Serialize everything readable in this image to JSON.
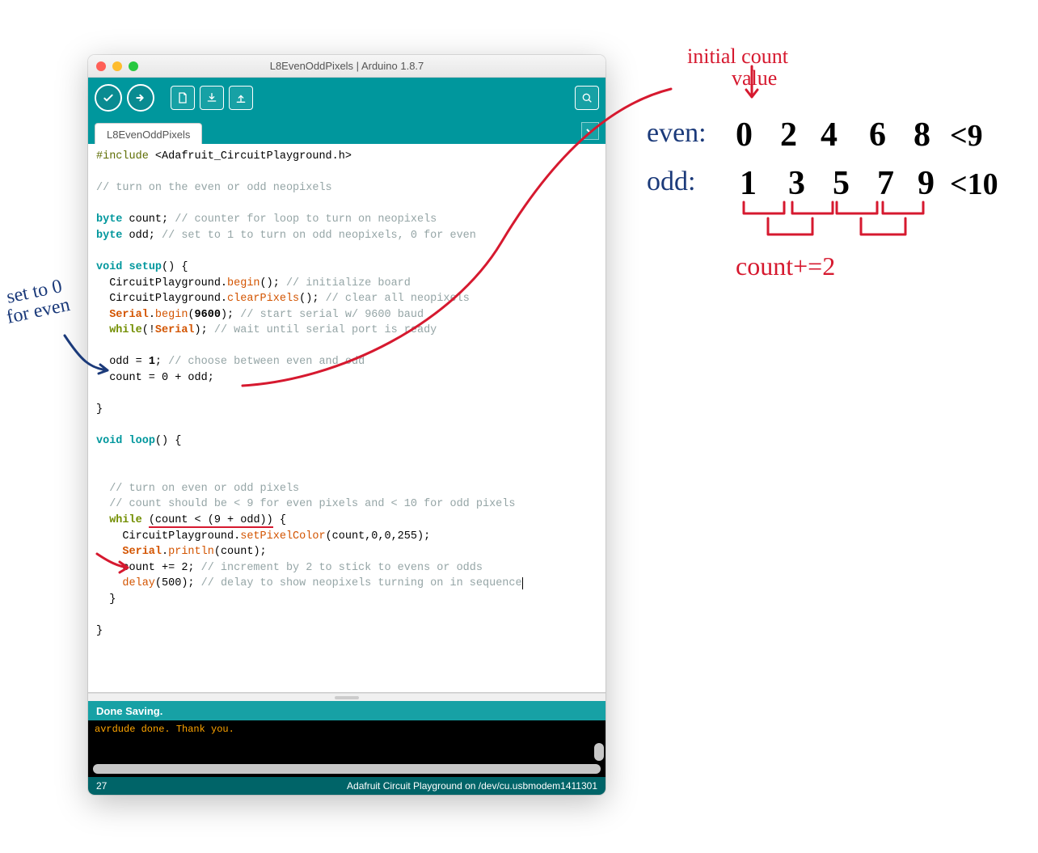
{
  "window": {
    "title": "L8EvenOddPixels | Arduino 1.8.7",
    "tab_label": "L8EvenOddPixels",
    "status_text": "Done Saving.",
    "console_text": "avrdude done.  Thank you.",
    "footer_line": "27",
    "footer_board": "Adafruit Circuit Playground on /dev/cu.usbmodem1411301"
  },
  "toolbar": {
    "buttons": {
      "verify": "verify",
      "upload": "upload",
      "new": "new",
      "open": "open",
      "save": "save",
      "serial": "serial-monitor"
    }
  },
  "code": {
    "l1a": "#include",
    "l1b": " <Adafruit_CircuitPlayground.h>",
    "l3": "// turn on the even or odd neopixels",
    "l5a": "byte",
    "l5b": " count; ",
    "l5c": "// counter for loop to turn on neopixels",
    "l6a": "byte",
    "l6b": " odd; ",
    "l6c": "// set to 1 to turn on odd neopixels, 0 for even",
    "l8a": "void",
    "l8b": " ",
    "l8c": "setup",
    "l8d": "() {",
    "l9a": "  CircuitPlayground.",
    "l9b": "begin",
    "l9c": "(); ",
    "l9d": "// initialize board",
    "l10a": "  CircuitPlayground.",
    "l10b": "clearPixels",
    "l10c": "(); ",
    "l10d": "// clear all neopixels",
    "l11a": "  ",
    "l11b": "Serial",
    "l11c": ".",
    "l11d": "begin",
    "l11e": "(",
    "l11f": "9600",
    "l11g": "); ",
    "l11h": "// start serial w/ 9600 baud",
    "l12a": "  ",
    "l12b": "while",
    "l12c": "(!",
    "l12d": "Serial",
    "l12e": "); ",
    "l12f": "// wait until serial port is ready",
    "l14a": "  odd = ",
    "l14b": "1",
    "l14c": "; ",
    "l14d": "// choose between even and odd",
    "l15": "  count = 0 + odd;",
    "l17": "}",
    "l19a": "void",
    "l19b": " ",
    "l19c": "loop",
    "l19d": "() {",
    "l22": "  // turn on even or odd pixels",
    "l23": "  // count should be < 9 for even pixels and < 10 for odd pixels",
    "l24a": "  ",
    "l24b": "while",
    "l24c": " ",
    "l24d": "(count < (9 + odd))",
    "l24e": " {",
    "l25a": "    CircuitPlayground.",
    "l25b": "setPixelColor",
    "l25c": "(count,0,0,255);",
    "l26a": "    ",
    "l26b": "Serial",
    "l26c": ".",
    "l26d": "println",
    "l26e": "(count);",
    "l27a": "    count += 2; ",
    "l27b": "// increment by 2 to stick to evens or odds",
    "l28a": "    ",
    "l28b": "delay",
    "l28c": "(500); ",
    "l28d": "// delay to show neopixels turning on in sequence",
    "l29": "  }",
    "l31": "}"
  },
  "annotations": {
    "set_forever_l1": "set to 0",
    "set_forever_l2": "for even",
    "initial_count_l1": "initial count",
    "initial_count_l2": "value",
    "even_label": "even:",
    "odd_label": "odd:",
    "even_vals": [
      "0",
      "2",
      "4",
      "6",
      "8"
    ],
    "even_cond": "<9",
    "odd_vals": [
      "1",
      "3",
      "5",
      "7",
      "9"
    ],
    "odd_cond": "<10",
    "count_plus": "count+=2"
  }
}
